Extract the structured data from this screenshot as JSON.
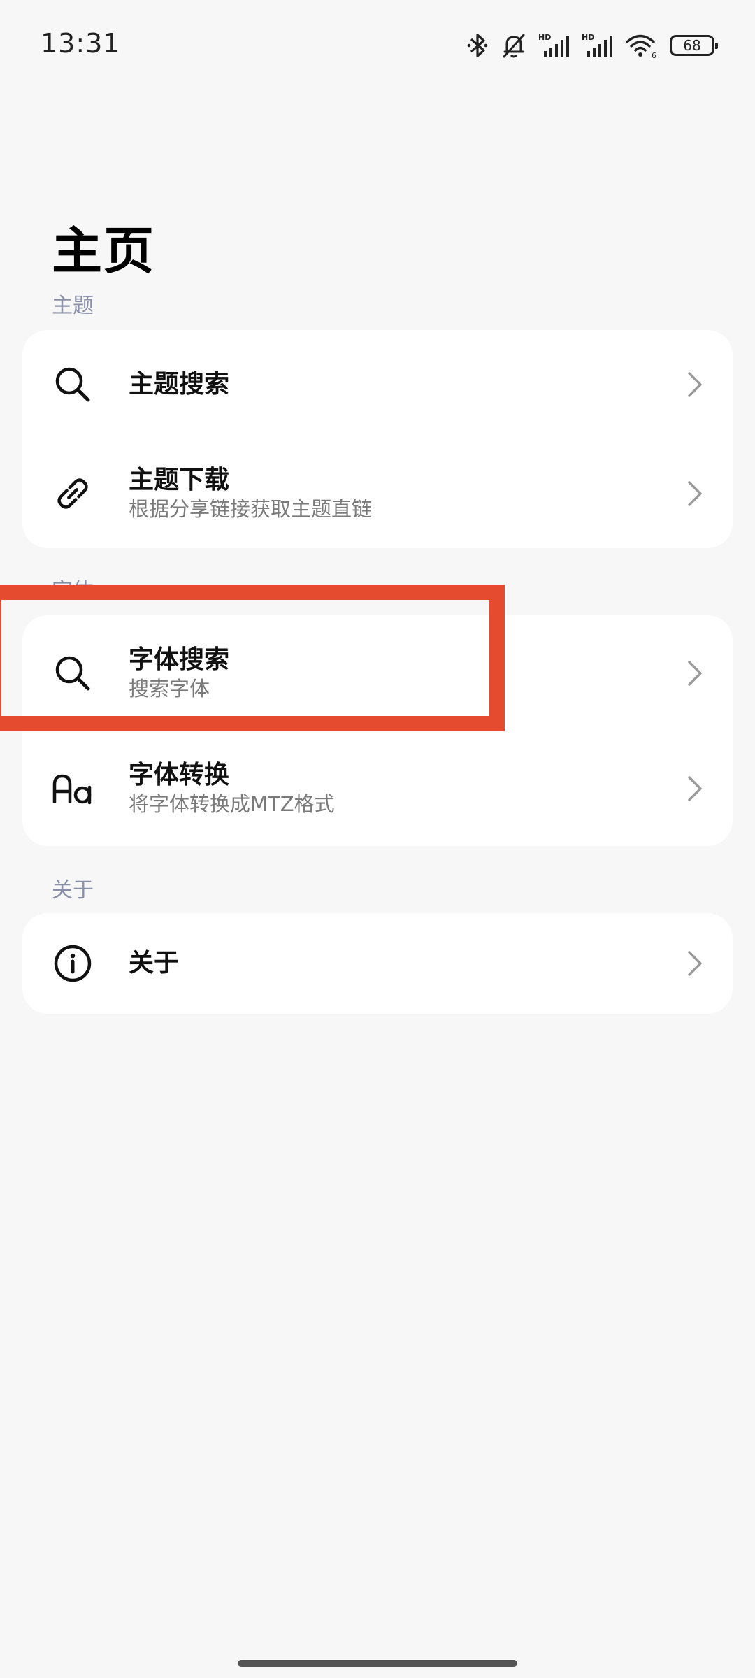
{
  "status_bar": {
    "time": "13:31",
    "battery": "68",
    "icons": [
      "bluetooth-icon",
      "mute-bell-icon",
      "hd-signal-icon",
      "hd-signal-icon",
      "wifi-icon",
      "battery-icon"
    ]
  },
  "page": {
    "title": "主页"
  },
  "sections": {
    "theme": {
      "label": "主题",
      "items": [
        {
          "icon": "search-icon",
          "title": "主题搜索",
          "subtitle": ""
        },
        {
          "icon": "link-icon",
          "title": "主题下载",
          "subtitle": "根据分享链接获取主题直链"
        }
      ]
    },
    "font": {
      "label": "字体",
      "items": [
        {
          "icon": "search-icon",
          "title": "字体搜索",
          "subtitle": "搜索字体"
        },
        {
          "icon": "font-aa-icon",
          "title": "字体转换",
          "subtitle": "将字体转换成MTZ格式"
        }
      ]
    },
    "about": {
      "label": "关于",
      "items": [
        {
          "icon": "info-icon",
          "title": "关于",
          "subtitle": ""
        }
      ]
    }
  },
  "colors": {
    "background": "#f7f7f7",
    "card": "#ffffff",
    "section_label": "#8a8fa8",
    "highlight": "#e44b2f",
    "chevron": "#9a9a9a"
  }
}
